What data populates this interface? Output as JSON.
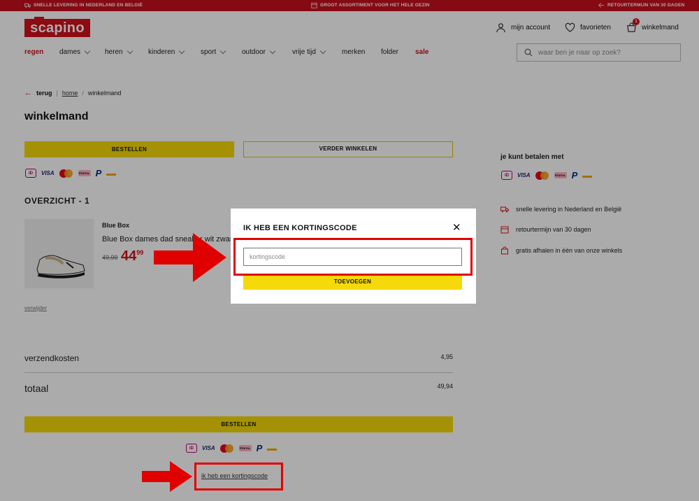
{
  "topbar": {
    "left": "SNELLE LEVERING IN NEDERLAND EN BELGIË",
    "center": "GROOT ASSORTIMENT VOOR HET HELE GEZIN",
    "right": "RETOURTERMIJN VAN 30 DAGEN"
  },
  "header": {
    "logo": "scapino",
    "account": "mijn account",
    "favorites": "favorieten",
    "cart": "winkelmand",
    "cart_count": "1",
    "search_placeholder": "waar ben je naar op zoek?"
  },
  "nav": {
    "items": [
      "regen",
      "dames",
      "heren",
      "kinderen",
      "sport",
      "outdoor",
      "vrije tijd",
      "merken",
      "folder",
      "sale"
    ]
  },
  "breadcrumb": {
    "back": "terug",
    "home": "home",
    "current": "winkelmand"
  },
  "page": {
    "title": "winkelmand",
    "order_button": "BESTELLEN",
    "continue_button": "VERDER WINKELEN",
    "overview_title": "OVERZICHT - 1"
  },
  "payment_logos": {
    "ideal": "iD",
    "visa": "VISA",
    "klarna": "Klarna.",
    "paypal": "P"
  },
  "product": {
    "brand": "Blue Box",
    "name": "Blue Box dames dad sneaker wit zwart",
    "old_price": "49,99",
    "price_main": "44",
    "price_cents": "99",
    "remove": "verwijder"
  },
  "summary": {
    "shipping_label": "verzendkosten",
    "shipping_value": "4,95",
    "total_label": "totaal",
    "total_value": "49,94",
    "order_button": "BESTELLEN",
    "discount_link": "ik heb een kortingscode"
  },
  "sidebar": {
    "pay_title": "je kunt betalen met",
    "usps": [
      "snelle levering in Nederland en België",
      "retourtermijn van 30 dagen",
      "gratis afhalen in één van onze winkels"
    ]
  },
  "modal": {
    "title": "IK HEB EEN KORTINGSCODE",
    "close": "✕",
    "input_placeholder": "kortingscode",
    "input_value": "",
    "submit": "TOEVOEGEN"
  },
  "colors": {
    "brand_red": "#d3111c",
    "button_yellow": "#f5d90a",
    "annotation_red": "#e10000"
  }
}
